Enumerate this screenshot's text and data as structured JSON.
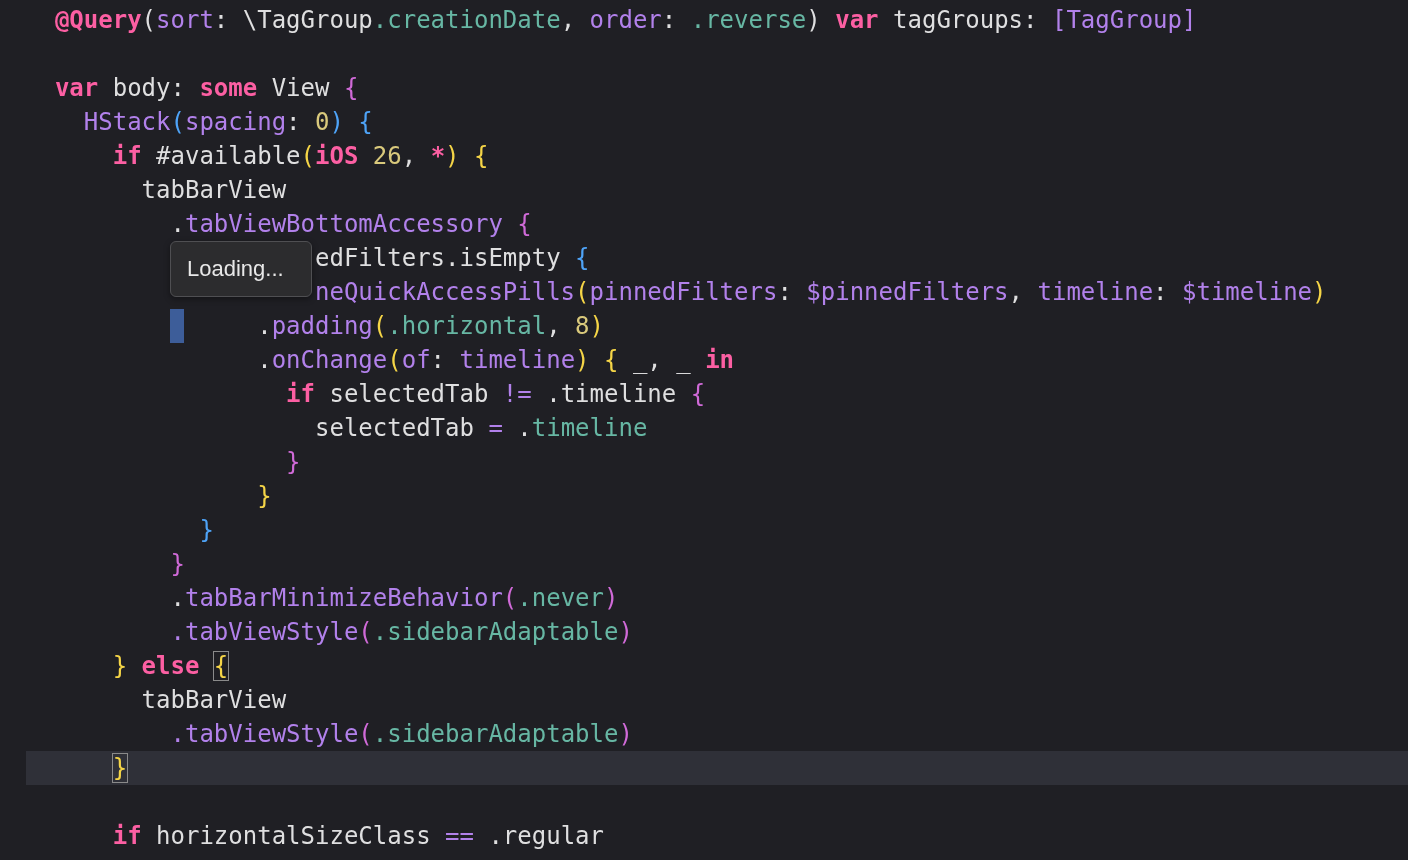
{
  "editor": {
    "lines": [
      {
        "kind": "code",
        "current": false,
        "marker": false,
        "tokens": [
          {
            "text": "  @Query",
            "kind": "kw"
          },
          {
            "text": "(",
            "kind": "plain"
          },
          {
            "text": "sort",
            "kind": "fn"
          },
          {
            "text": ": \\TagGroup",
            "kind": "plain"
          },
          {
            "text": ".creationDate",
            "kind": "case"
          },
          {
            "text": ", ",
            "kind": "plain"
          },
          {
            "text": "order",
            "kind": "fn"
          },
          {
            "text": ": ",
            "kind": "plain"
          },
          {
            "text": ".reverse",
            "kind": "case"
          },
          {
            "text": ") ",
            "kind": "plain"
          },
          {
            "text": "var",
            "kind": "kw"
          },
          {
            "text": " tagGroups: ",
            "kind": "plain"
          },
          {
            "text": "[TagGroup]",
            "kind": "fn"
          }
        ]
      },
      {
        "kind": "blank",
        "current": false,
        "marker": false
      },
      {
        "kind": "code",
        "current": false,
        "marker": false,
        "tokens": [
          {
            "text": "  var",
            "kind": "kw"
          },
          {
            "text": " body: ",
            "kind": "plain"
          },
          {
            "text": "some",
            "kind": "kw"
          },
          {
            "text": " View ",
            "kind": "plain"
          },
          {
            "text": "{",
            "kind": "bp"
          }
        ]
      },
      {
        "kind": "code",
        "current": false,
        "marker": false,
        "tokens": [
          {
            "text": "    HStack",
            "kind": "fn"
          },
          {
            "text": "(",
            "kind": "bb"
          },
          {
            "text": "spacing",
            "kind": "fn"
          },
          {
            "text": ": ",
            "kind": "plain"
          },
          {
            "text": "0",
            "kind": "num"
          },
          {
            "text": ")",
            "kind": "bb"
          },
          {
            "text": " {",
            "kind": "bb"
          }
        ]
      },
      {
        "kind": "code",
        "current": false,
        "marker": false,
        "tokens": [
          {
            "text": "      if",
            "kind": "kw"
          },
          {
            "text": " #available",
            "kind": "plain"
          },
          {
            "text": "(",
            "kind": "by"
          },
          {
            "text": "iOS",
            "kind": "kw"
          },
          {
            "text": " 26",
            "kind": "num"
          },
          {
            "text": ", ",
            "kind": "plain"
          },
          {
            "text": "*",
            "kind": "kw"
          },
          {
            "text": ")",
            "kind": "by"
          },
          {
            "text": " {",
            "kind": "by"
          }
        ]
      },
      {
        "kind": "code",
        "current": false,
        "marker": false,
        "tokens": [
          {
            "text": "        tabBarView",
            "kind": "plain"
          }
        ]
      },
      {
        "kind": "code",
        "current": false,
        "marker": false,
        "tokens": [
          {
            "text": "          .",
            "kind": "plain"
          },
          {
            "text": "tabViewBottomAccessory",
            "kind": "fn"
          },
          {
            "text": " {",
            "kind": "bp"
          }
        ]
      },
      {
        "kind": "code",
        "current": false,
        "marker": false,
        "tokens": [
          {
            "text": "                    edFilters.isEmpty",
            "kind": "plain"
          },
          {
            "text": " {",
            "kind": "bb"
          }
        ]
      },
      {
        "kind": "code",
        "current": false,
        "marker": false,
        "tokens": [
          {
            "text": "                    neQuickAccessPills",
            "kind": "fn"
          },
          {
            "text": "(",
            "kind": "by"
          },
          {
            "text": "pinnedFilters",
            "kind": "fn"
          },
          {
            "text": ": ",
            "kind": "plain"
          },
          {
            "text": "$pinnedFilters",
            "kind": "fn"
          },
          {
            "text": ", ",
            "kind": "plain"
          },
          {
            "text": "timeline",
            "kind": "fn"
          },
          {
            "text": ": ",
            "kind": "plain"
          },
          {
            "text": "$timeline",
            "kind": "fn"
          },
          {
            "text": ")",
            "kind": "by"
          }
        ]
      },
      {
        "kind": "code",
        "current": false,
        "marker": true,
        "tokens": [
          {
            "text": "                .",
            "kind": "plain"
          },
          {
            "text": "padding",
            "kind": "fn"
          },
          {
            "text": "(",
            "kind": "by"
          },
          {
            "text": ".horizontal",
            "kind": "case"
          },
          {
            "text": ", ",
            "kind": "plain"
          },
          {
            "text": "8",
            "kind": "num"
          },
          {
            "text": ")",
            "kind": "by"
          }
        ]
      },
      {
        "kind": "code",
        "current": false,
        "marker": false,
        "tokens": [
          {
            "text": "                .",
            "kind": "plain"
          },
          {
            "text": "onChange",
            "kind": "fn"
          },
          {
            "text": "(",
            "kind": "by"
          },
          {
            "text": "of",
            "kind": "fn"
          },
          {
            "text": ": ",
            "kind": "plain"
          },
          {
            "text": "timeline",
            "kind": "fn"
          },
          {
            "text": ")",
            "kind": "by"
          },
          {
            "text": " {",
            "kind": "by"
          },
          {
            "text": " _, _ ",
            "kind": "plain"
          },
          {
            "text": "in",
            "kind": "kw"
          }
        ]
      },
      {
        "kind": "code",
        "current": false,
        "marker": false,
        "tokens": [
          {
            "text": "                  if",
            "kind": "kw"
          },
          {
            "text": " selectedTab ",
            "kind": "plain"
          },
          {
            "text": "!=",
            "kind": "op"
          },
          {
            "text": " .timeline ",
            "kind": "plain"
          },
          {
            "text": "{",
            "kind": "bp"
          }
        ]
      },
      {
        "kind": "code",
        "current": false,
        "marker": false,
        "tokens": [
          {
            "text": "                    selectedTab ",
            "kind": "plain"
          },
          {
            "text": "=",
            "kind": "op"
          },
          {
            "text": " .",
            "kind": "plain"
          },
          {
            "text": "timeline",
            "kind": "case"
          }
        ]
      },
      {
        "kind": "code",
        "current": false,
        "marker": false,
        "tokens": [
          {
            "text": "                  }",
            "kind": "bp"
          }
        ]
      },
      {
        "kind": "code",
        "current": false,
        "marker": false,
        "tokens": [
          {
            "text": "                }",
            "kind": "by"
          }
        ]
      },
      {
        "kind": "code",
        "current": false,
        "marker": false,
        "tokens": [
          {
            "text": "            }",
            "kind": "bb"
          }
        ]
      },
      {
        "kind": "code",
        "current": false,
        "marker": false,
        "tokens": [
          {
            "text": "          }",
            "kind": "bp"
          }
        ]
      },
      {
        "kind": "code",
        "current": false,
        "marker": false,
        "tokens": [
          {
            "text": "          .",
            "kind": "plain"
          },
          {
            "text": "tabBarMinimizeBehavior",
            "kind": "fn"
          },
          {
            "text": "(",
            "kind": "bp"
          },
          {
            "text": ".never",
            "kind": "case"
          },
          {
            "text": ")",
            "kind": "bp"
          }
        ]
      },
      {
        "kind": "code",
        "current": false,
        "marker": false,
        "tokens": [
          {
            "text": "          .tabViewStyle",
            "kind": "fn"
          },
          {
            "text": "(",
            "kind": "bp"
          },
          {
            "text": ".sidebarAdaptable",
            "kind": "case"
          },
          {
            "text": ")",
            "kind": "bp"
          }
        ]
      },
      {
        "kind": "code",
        "current": false,
        "marker": false,
        "tokens": [
          {
            "text": "      }",
            "kind": "by"
          },
          {
            "text": " else ",
            "kind": "kw"
          },
          {
            "text": "{",
            "kind": "by",
            "boxed": true
          }
        ]
      },
      {
        "kind": "code",
        "current": false,
        "marker": false,
        "tokens": [
          {
            "text": "        tabBarView",
            "kind": "plain"
          }
        ]
      },
      {
        "kind": "code",
        "current": false,
        "marker": false,
        "tokens": [
          {
            "text": "          .tabViewStyle",
            "kind": "fn"
          },
          {
            "text": "(",
            "kind": "bp"
          },
          {
            "text": ".sidebarAdaptable",
            "kind": "case"
          },
          {
            "text": ")",
            "kind": "bp"
          }
        ]
      },
      {
        "kind": "code",
        "current": true,
        "marker": false,
        "tokens": [
          {
            "text": "      }",
            "kind": "by",
            "boxed": true
          }
        ]
      },
      {
        "kind": "blank",
        "current": false,
        "marker": false
      },
      {
        "kind": "code",
        "current": false,
        "marker": false,
        "tokens": [
          {
            "text": "      if",
            "kind": "kw"
          },
          {
            "text": " horizontalSizeClass ",
            "kind": "plain"
          },
          {
            "text": "==",
            "kind": "op"
          },
          {
            "text": " .regular",
            "kind": "plain"
          }
        ]
      }
    ]
  },
  "tooltip": {
    "text": "Loading..."
  }
}
